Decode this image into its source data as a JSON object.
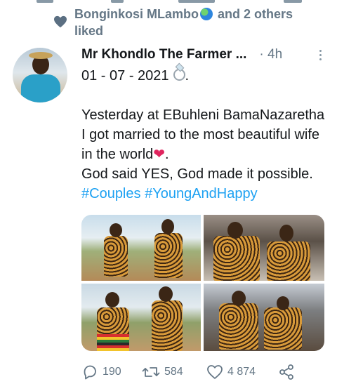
{
  "social_context": {
    "text_before": "Bonginkosi MLambo",
    "text_after": " and 2 others liked"
  },
  "tweet": {
    "author": "Mr Khondlo The Farmer ...",
    "time": "· 4h",
    "date_line": "01 - 07 - 2021",
    "text_line1": "Yesterday at EBuhleni BamaNazaretha I got married to the most beautiful wife in the world",
    "text_line2": "God said YES, God made it possible.",
    "hashtags": [
      "#Couples",
      "#YoungAndHappy"
    ]
  },
  "actions": {
    "replies": "190",
    "retweets": "584",
    "likes": "4 874"
  },
  "icons": {
    "liked": "heart-icon",
    "more": "more-vertical-icon",
    "reply": "reply-icon",
    "retweet": "retweet-icon",
    "like": "like-icon",
    "share": "share-icon",
    "ring": "ring-emoji-icon",
    "globe": "globe-emoji-icon"
  },
  "colors": {
    "muted": "#657786",
    "hashtag": "#1da1f2",
    "emoji_heart": "#e0245e"
  }
}
